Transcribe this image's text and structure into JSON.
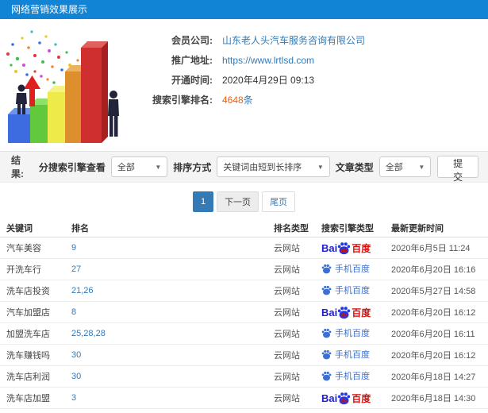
{
  "header": {
    "title": "网络营销效果展示",
    "bg_color": "#1184d5"
  },
  "info": {
    "company_label": "会员公司:",
    "company_value": "山东老人头汽车服务咨询有限公司",
    "promo_label": "推广地址:",
    "promo_value": "https://www.lrtlsd.com",
    "open_label": "开通时间:",
    "open_value": "2020年4月29日 09:13",
    "rank_label": "搜索引擎排名:",
    "rank_count": "4648",
    "rank_unit": "条"
  },
  "filters": {
    "result_label": "结果:",
    "engine_label": "分搜索引擎查看",
    "engine_value": "全部",
    "sort_label": "排序方式",
    "sort_value": "关键词由短到长排序",
    "article_label": "文章类型",
    "article_value": "全部",
    "submit_label": "提交",
    "caret": "▼"
  },
  "pagination": {
    "current": "1",
    "next": "下一页",
    "last": "尾页"
  },
  "table": {
    "headers": [
      "关键词",
      "排名",
      "排名类型",
      "搜索引擎类型",
      "最新更新时间"
    ],
    "rows": [
      {
        "keyword": "汽车美容",
        "rank": "9",
        "rank_type": "云网站",
        "engine": "baidu",
        "updated": "2020年6月5日 11:24"
      },
      {
        "keyword": "开洗车行",
        "rank": "27",
        "rank_type": "云网站",
        "engine": "mobile-baidu",
        "updated": "2020年6月20日 16:16"
      },
      {
        "keyword": "洗车店投资",
        "rank": "21,26",
        "rank_type": "云网站",
        "engine": "mobile-baidu",
        "updated": "2020年5月27日 14:58"
      },
      {
        "keyword": "汽车加盟店",
        "rank": "8",
        "rank_type": "云网站",
        "engine": "baidu",
        "updated": "2020年6月20日 16:12"
      },
      {
        "keyword": "加盟洗车店",
        "rank": "25,28,28",
        "rank_type": "云网站",
        "engine": "mobile-baidu",
        "updated": "2020年6月20日 16:11"
      },
      {
        "keyword": "洗车赚钱吗",
        "rank": "30",
        "rank_type": "云网站",
        "engine": "mobile-baidu",
        "updated": "2020年6月20日 16:12"
      },
      {
        "keyword": "洗车店利润",
        "rank": "30",
        "rank_type": "云网站",
        "engine": "mobile-baidu",
        "updated": "2020年6月18日 14:27"
      },
      {
        "keyword": "洗车店加盟",
        "rank": "3",
        "rank_type": "云网站",
        "engine": "baidu",
        "updated": "2020年6月18日 14:30"
      }
    ]
  },
  "engines": {
    "baidu": {
      "bai": "Bai",
      "du": "du",
      "cn": "百度",
      "blue": "#2737e0",
      "red": "#d2120e"
    },
    "mobile": {
      "label": "手机百度",
      "color": "#3b6fd4"
    }
  },
  "colors": {
    "accent_blue": "#337ab7",
    "orange": "#ff5a00",
    "topbar_blue": "#1184d5"
  }
}
